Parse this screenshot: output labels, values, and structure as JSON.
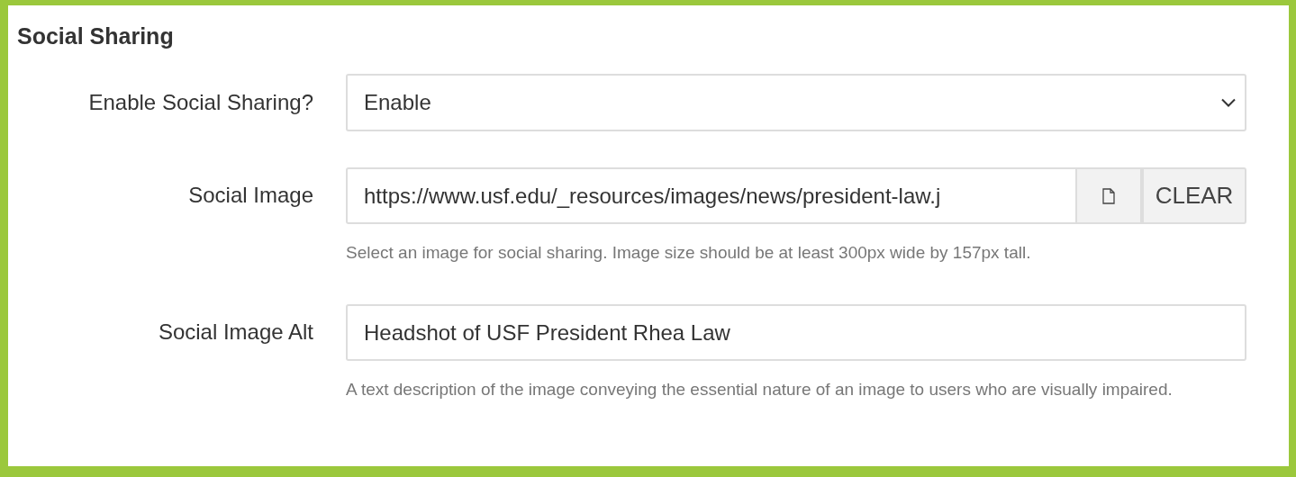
{
  "section": {
    "title": "Social Sharing"
  },
  "fields": [
    {
      "kind": "select",
      "label": "Enable Social Sharing?",
      "value": "Enable"
    },
    {
      "kind": "file",
      "label": "Social Image",
      "value": "https://www.usf.edu/_resources/images/news/president-law.j",
      "clear_button": "CLEAR",
      "help": "Select an image for social sharing. Image size should be at least 300px wide by 157px tall."
    },
    {
      "kind": "text",
      "label": "Social Image Alt",
      "value": "Headshot of USF President Rhea Law",
      "help": "A text description of the image conveying the essential nature of an image to users who are visually impaired."
    }
  ]
}
